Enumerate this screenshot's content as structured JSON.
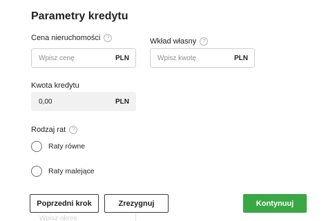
{
  "section_title": "Parametry kredytu",
  "fields": {
    "price": {
      "label": "Cena nieruchomości",
      "placeholder": "Wpisz cenę",
      "unit": "PLN"
    },
    "own_contribution": {
      "label": "Wkład własny",
      "placeholder": "Wpisz kwotę",
      "unit": "PLN"
    },
    "loan_amount": {
      "label": "Kwota kredytu",
      "value": "0,00",
      "unit": "PLN"
    }
  },
  "help_glyph": "?",
  "installments": {
    "label": "Rodzaj rat",
    "options": [
      {
        "label": "Raty równe",
        "selected": false
      },
      {
        "label": "Raty malejące",
        "selected": false
      }
    ]
  },
  "buttons": {
    "previous": "Poprzedni krok",
    "cancel": "Zrezygnuj",
    "continue": "Kontynuuj"
  },
  "partial_field_label": "Wpisz okres",
  "colors": {
    "primary": "#3aa845",
    "text": "#222222",
    "border": "#cfcfcf"
  }
}
